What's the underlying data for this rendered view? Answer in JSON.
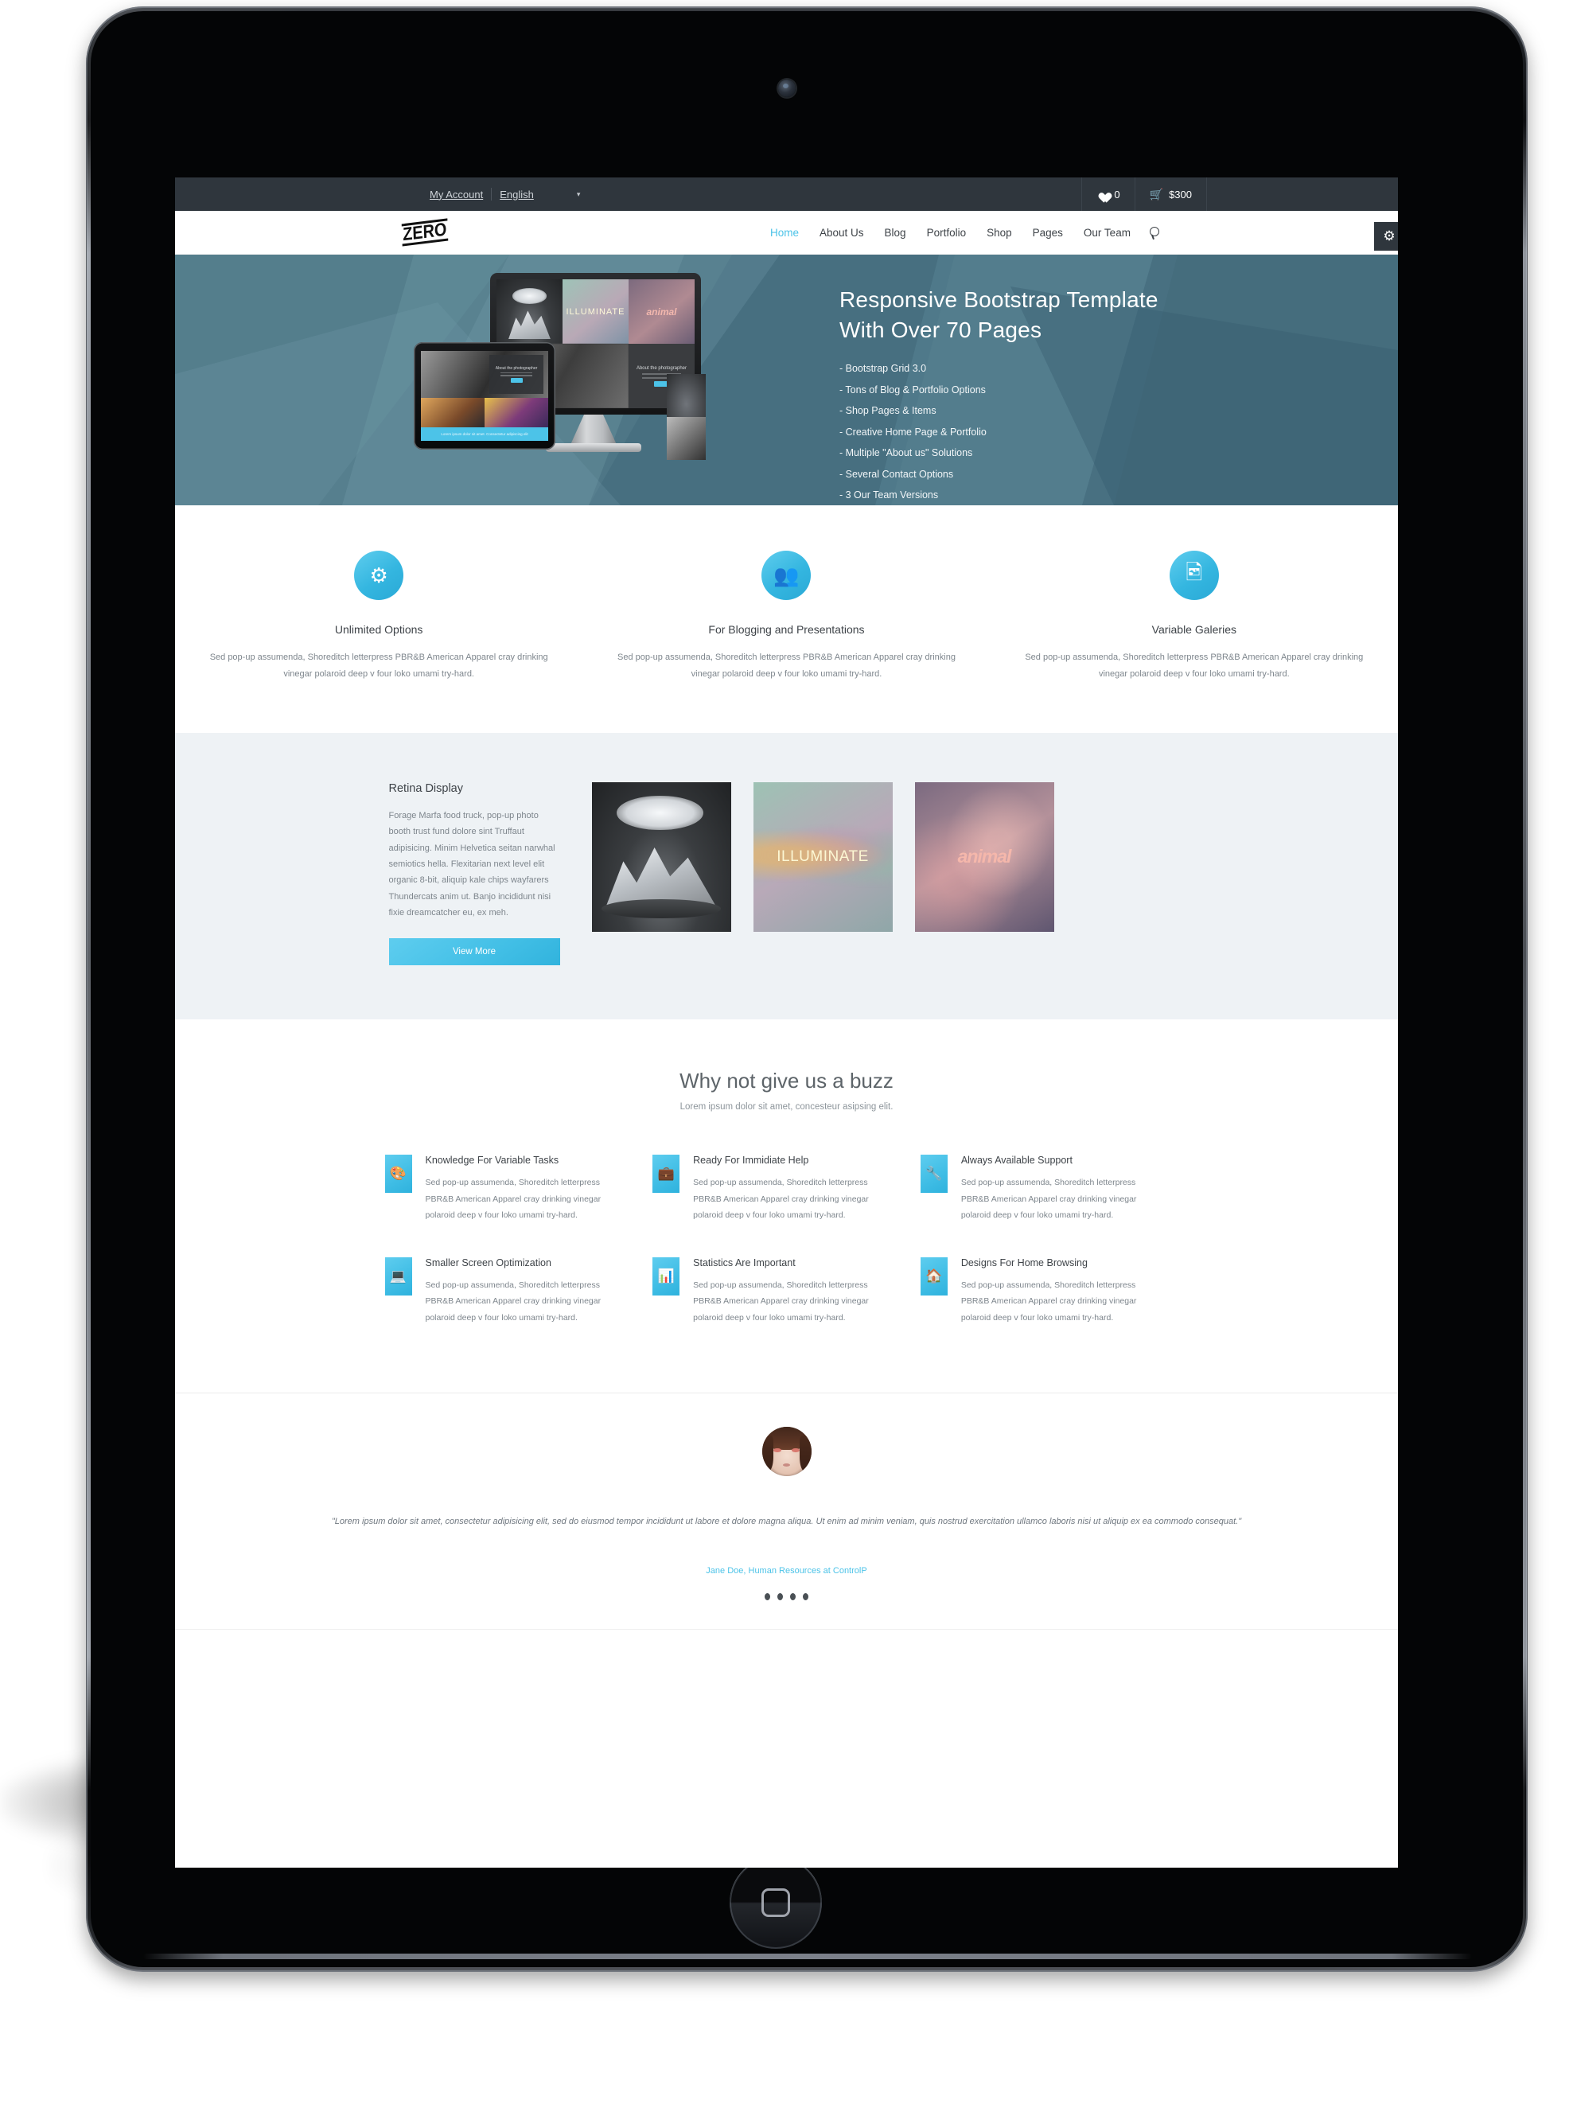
{
  "topbar": {
    "my_account": "My Account",
    "language": "English",
    "caret": "▾",
    "wishlist_icon": "heart-icon",
    "wishlist_count": "0",
    "cart_icon": "cart-icon",
    "cart_total": "$300"
  },
  "header": {
    "logo_text": "ZERO",
    "nav": [
      {
        "label": "Home",
        "active": true
      },
      {
        "label": "About Us",
        "active": false
      },
      {
        "label": "Blog",
        "active": false
      },
      {
        "label": "Portfolio",
        "active": false
      },
      {
        "label": "Shop",
        "active": false
      },
      {
        "label": "Pages",
        "active": false
      },
      {
        "label": "Our Team",
        "active": false
      }
    ],
    "search_icon": "search-icon",
    "settings_icon": "gear-icon"
  },
  "hero": {
    "title_line1": "Responsive Bootstrap Template",
    "title_line2": "With Over 70 Pages",
    "bullets": [
      "- Bootstrap Grid 3.0",
      "- Tons of Blog & Portfolio Options",
      "- Shop Pages & Items",
      "- Creative Home Page & Portfolio",
      "- Multiple \"About us\" Solutions",
      "- Several Contact Options",
      "- 3 Our Team Versions"
    ],
    "device_tiles": {
      "illuminate": "ILLUMINATE",
      "animal": "animal",
      "about_photographer": "About the photographer",
      "tablet_caption": "Lorem ipsum dolor sit amet. Consectetur adipiscing elit"
    },
    "background_color": "#4d7685"
  },
  "features": [
    {
      "icon": "gears-icon",
      "title": "Unlimited Options",
      "text": "Sed pop-up assumenda, Shoreditch letterpress PBR&B American Apparel cray drinking vinegar polaroid deep v four loko umami try-hard."
    },
    {
      "icon": "users-icon",
      "title": "For Blogging and Presentations",
      "text": "Sed pop-up assumenda, Shoreditch letterpress PBR&B American Apparel cray drinking vinegar polaroid deep v four loko umami try-hard."
    },
    {
      "icon": "image-icon",
      "title": "Variable Galeries",
      "text": "Sed pop-up assumenda, Shoreditch letterpress PBR&B American Apparel cray drinking vinegar polaroid deep v four loko umami try-hard."
    }
  ],
  "retina": {
    "title": "Retina Display",
    "text": "Forage Marfa food truck, pop-up photo booth trust fund dolore sint Truffaut adipisicing. Minim Helvetica seitan narwhal semiotics hella. Flexitarian next level elit organic 8-bit, aliquip kale chips wayfarers Thundercats anim ut. Banjo incididunt nisi fixie dreamcatcher eu, ex meh.",
    "button_label": "View More",
    "gallery": [
      {
        "name": "mountain-cloud-artwork",
        "caption": ""
      },
      {
        "name": "illuminate-artwork",
        "caption": "ILLUMINATE"
      },
      {
        "name": "animal-artwork",
        "caption": "animal"
      }
    ],
    "background_color": "#eef2f5"
  },
  "buzz": {
    "heading": "Why not give us a buzz",
    "subheading": "Lorem ipsum dolor sit amet, concesteur asipsing elit.",
    "items": [
      {
        "icon": "palette-icon",
        "title": "Knowledge For Variable Tasks",
        "text": "Sed pop-up assumenda, Shoreditch letterpress PBR&B American Apparel cray drinking vinegar polaroid deep v four loko umami try-hard."
      },
      {
        "icon": "briefcase-icon",
        "title": "Ready For Immidiate Help",
        "text": "Sed pop-up assumenda, Shoreditch letterpress PBR&B American Apparel cray drinking vinegar polaroid deep v four loko umami try-hard."
      },
      {
        "icon": "wrench-icon",
        "title": "Always Available Support",
        "text": "Sed pop-up assumenda, Shoreditch letterpress PBR&B American Apparel cray drinking vinegar polaroid deep v four loko umami try-hard."
      },
      {
        "icon": "laptop-icon",
        "title": "Smaller Screen Optimization",
        "text": "Sed pop-up assumenda, Shoreditch letterpress PBR&B American Apparel cray drinking vinegar polaroid deep v four loko umami try-hard."
      },
      {
        "icon": "bar-chart-icon",
        "title": "Statistics Are Important",
        "text": "Sed pop-up assumenda, Shoreditch letterpress PBR&B American Apparel cray drinking vinegar polaroid deep v four loko umami try-hard."
      },
      {
        "icon": "home-icon",
        "title": "Designs For Home Browsing",
        "text": "Sed pop-up assumenda, Shoreditch letterpress PBR&B American Apparel cray drinking vinegar polaroid deep v four loko umami try-hard."
      }
    ]
  },
  "testimonial": {
    "avatar": "user-avatar",
    "quote": "\"Lorem ipsum dolor sit amet, consectetur adipisicing elit, sed do eiusmod tempor incididunt ut labore et dolore magna aliqua. Ut enim ad minim veniam, quis nostrud exercitation ullamco laboris nisi ut aliquip ex ea commodo consequat.\"",
    "author": "Jane Doe, Human Resources at ControlP",
    "slide_count": 4,
    "accent_color": "#4cc3e8"
  },
  "theme": {
    "accent": "#4cc3e8",
    "dark": "#2f363d",
    "text": "#3e4348",
    "muted": "#7e868d"
  }
}
